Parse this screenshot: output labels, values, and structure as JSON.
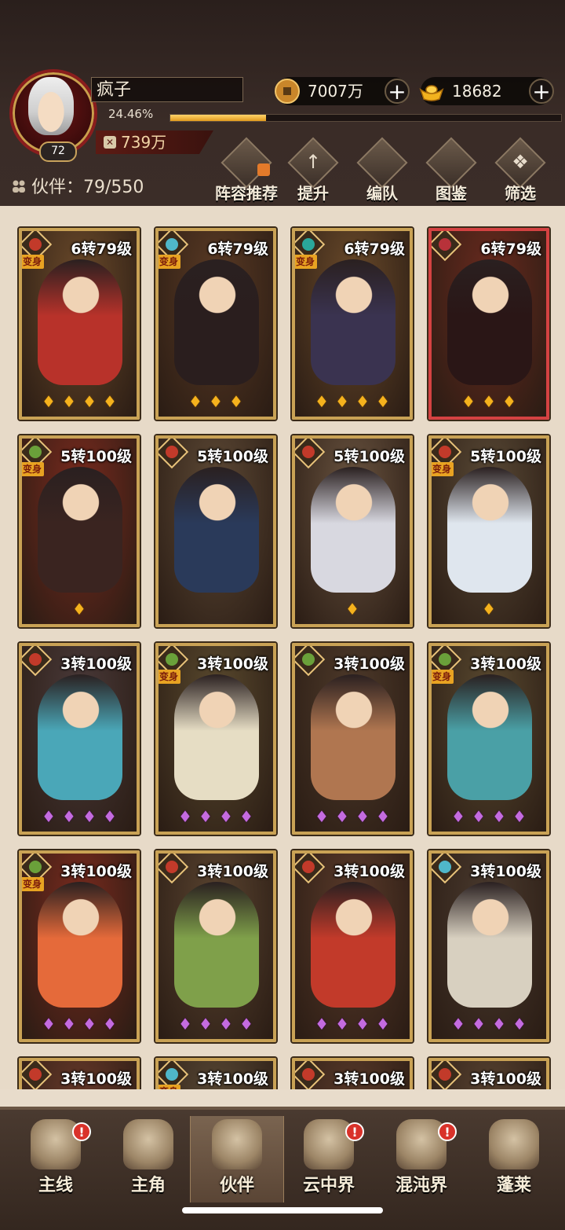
{
  "player": {
    "name": "疯子",
    "level": "72",
    "exp_text": "24.46%",
    "exp_fraction": 0.2446,
    "power": "739万"
  },
  "currencies": {
    "coin": {
      "value": "7007万",
      "icon": "coin-icon"
    },
    "gold": {
      "value": "18682",
      "icon": "gold-ingot-icon"
    }
  },
  "partners": {
    "label": "伙伴：",
    "count": "79/550"
  },
  "toolbar": {
    "items": [
      {
        "label": "阵容推荐",
        "icon": "lineup-icon"
      },
      {
        "label": "提升",
        "icon": "upgrade-icon"
      },
      {
        "label": "编队",
        "icon": "formation-icon"
      },
      {
        "label": "图鉴",
        "icon": "codex-icon"
      },
      {
        "label": "筛选",
        "icon": "filter-icon"
      }
    ]
  },
  "cards": [
    {
      "rank": "6转79级",
      "badge": "bianshen",
      "badge_label": "变身",
      "faction_color": "#c23a2a",
      "stars": 4,
      "star_color": "gold",
      "frame": "gold",
      "bg": "#6b4a2a",
      "fig": "#b8322a"
    },
    {
      "rank": "6转79级",
      "badge": "bianshen",
      "badge_label": "变身",
      "faction_color": "#4fb7c9",
      "stars": 3,
      "star_color": "gold",
      "frame": "gold",
      "bg": "#5a3a24",
      "fig": "#2a1e1e"
    },
    {
      "rank": "6转79级",
      "badge": "bianshen",
      "badge_label": "变身",
      "faction_color": "#2aa79a",
      "stars": 4,
      "star_color": "gold",
      "frame": "gold",
      "bg": "#6a4a2a",
      "fig": "#3a3350"
    },
    {
      "rank": "6转79级",
      "badge": "",
      "badge_label": "",
      "faction_color": "#b8323a",
      "stars": 3,
      "star_color": "gold",
      "frame": "red",
      "bg": "#6a2a1e",
      "fig": "#2a1616"
    },
    {
      "rank": "5转100级",
      "badge": "bianshen",
      "badge_label": "变身",
      "faction_color": "#6aa03a",
      "stars": 1,
      "star_color": "gold",
      "frame": "gold",
      "bg": "#7a2a1e",
      "fig": "#3a2420"
    },
    {
      "rank": "5转100级",
      "badge": "",
      "badge_label": "",
      "faction_color": "#c23a2a",
      "stars": 0,
      "star_color": "gold",
      "frame": "gold",
      "bg": "#5e4a36",
      "fig": "#2a3a5a"
    },
    {
      "rank": "5转100级",
      "badge": "",
      "badge_label": "",
      "faction_color": "#c23a2a",
      "stars": 1,
      "star_color": "gold",
      "frame": "gold",
      "bg": "#6a5440",
      "fig": "#d8d8e0"
    },
    {
      "rank": "5转100级",
      "badge": "bianshen",
      "badge_label": "变身",
      "faction_color": "#c23a2a",
      "stars": 1,
      "star_color": "gold",
      "frame": "gold",
      "bg": "#5a4a36",
      "fig": "#dfe6ee"
    },
    {
      "rank": "3转100级",
      "badge": "",
      "badge_label": "",
      "faction_color": "#c23a2a",
      "stars": 4,
      "star_color": "purple",
      "frame": "gold",
      "bg": "#4a3a3a",
      "fig": "#4aa7b8"
    },
    {
      "rank": "3转100级",
      "badge": "bianshen",
      "badge_label": "变身",
      "faction_color": "#6aa03a",
      "stars": 4,
      "star_color": "purple",
      "frame": "gold",
      "bg": "#5a4a2e",
      "fig": "#e6ddc4"
    },
    {
      "rank": "3转100级",
      "badge": "",
      "badge_label": "",
      "faction_color": "#6aa03a",
      "stars": 4,
      "star_color": "purple",
      "frame": "gold",
      "bg": "#4e3a2a",
      "fig": "#b07650"
    },
    {
      "rank": "3转100级",
      "badge": "bianshen",
      "badge_label": "变身",
      "faction_color": "#6aa03a",
      "stars": 4,
      "star_color": "purple",
      "frame": "gold",
      "bg": "#5a4a30",
      "fig": "#4aa0a6"
    },
    {
      "rank": "3转100级",
      "badge": "bianshen",
      "badge_label": "变身",
      "faction_color": "#6aa03a",
      "stars": 4,
      "star_color": "purple",
      "frame": "gold",
      "bg": "#7a2a1e",
      "fig": "#e56a3a"
    },
    {
      "rank": "3转100级",
      "badge": "",
      "badge_label": "",
      "faction_color": "#c23a2a",
      "stars": 4,
      "star_color": "purple",
      "frame": "gold",
      "bg": "#5a4430",
      "fig": "#7fa04a"
    },
    {
      "rank": "3转100级",
      "badge": "",
      "badge_label": "",
      "faction_color": "#c23a2a",
      "stars": 4,
      "star_color": "purple",
      "frame": "gold",
      "bg": "#5a3a2a",
      "fig": "#c23a2a"
    },
    {
      "rank": "3转100级",
      "badge": "",
      "badge_label": "",
      "faction_color": "#4fb7c9",
      "stars": 4,
      "star_color": "purple",
      "frame": "gold",
      "bg": "#4a3a2e",
      "fig": "#d8d0c0"
    },
    {
      "rank": "3转100级",
      "badge": "",
      "badge_label": "",
      "faction_color": "#c23a2a",
      "stars": 0,
      "star_color": "purple",
      "frame": "gold",
      "bg": "#6a3a2a",
      "fig": "#7a2a1e"
    },
    {
      "rank": "3转100级",
      "badge": "bianshen",
      "badge_label": "变身",
      "faction_color": "#4fb7c9",
      "stars": 0,
      "star_color": "purple",
      "frame": "gold",
      "bg": "#5a4a36",
      "fig": "#3a3a3a"
    },
    {
      "rank": "3转100级",
      "badge": "",
      "badge_label": "",
      "faction_color": "#c23a2a",
      "stars": 0,
      "star_color": "purple",
      "frame": "gold",
      "bg": "#5a3a2a",
      "fig": "#3a2a2a"
    },
    {
      "rank": "3转100级",
      "badge": "",
      "badge_label": "",
      "faction_color": "#c23a2a",
      "stars": 0,
      "star_color": "purple",
      "frame": "gold",
      "bg": "#5a4432",
      "fig": "#3a3a3a"
    }
  ],
  "bottom_nav": {
    "items": [
      {
        "label": "主线",
        "icon": "crossed-swords-icon",
        "alert": "!"
      },
      {
        "label": "主角",
        "icon": "hero-icon",
        "alert": ""
      },
      {
        "label": "伙伴",
        "icon": "partner-icon",
        "alert": "",
        "active": true
      },
      {
        "label": "云中界",
        "icon": "cloud-realm-icon",
        "alert": "!"
      },
      {
        "label": "混沌界",
        "icon": "chaos-realm-icon",
        "alert": "!"
      },
      {
        "label": "蓬莱",
        "icon": "penglai-icon",
        "alert": ""
      }
    ]
  }
}
